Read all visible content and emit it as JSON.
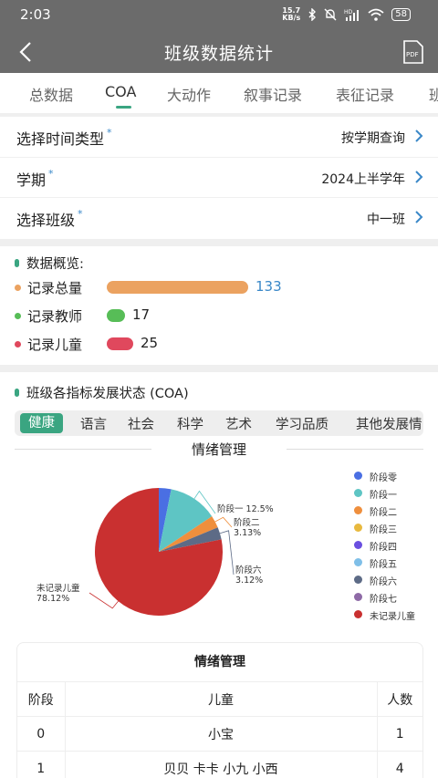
{
  "status_bar": {
    "time": "2:03",
    "net_speed_value": "15.7",
    "net_speed_unit": "KB/s",
    "battery": "58"
  },
  "header": {
    "title": "班级数据统计",
    "pdf_label": "PDF"
  },
  "tabs": [
    {
      "label": "总数据"
    },
    {
      "label": "COA"
    },
    {
      "label": "大动作"
    },
    {
      "label": "叙事记录"
    },
    {
      "label": "表征记录"
    },
    {
      "label": "班"
    }
  ],
  "filters": {
    "time_type": {
      "label": "选择时间类型",
      "required": "*",
      "value": "按学期查询"
    },
    "term": {
      "label": "学期",
      "required": "*",
      "value": "2024上半学年"
    },
    "class": {
      "label": "选择班级",
      "required": "*",
      "value": "中一班"
    }
  },
  "overview": {
    "title": "数据概览:",
    "rows": [
      {
        "label": "记录总量",
        "value": "133",
        "count": 133,
        "color": "#eba260",
        "value_color": "#3a88c8"
      },
      {
        "label": "记录教师",
        "value": "17",
        "count": 17,
        "color": "#57bd57",
        "value_color": "#222222"
      },
      {
        "label": "记录儿童",
        "value": "25",
        "count": 25,
        "color": "#e0485d",
        "value_color": "#222222"
      }
    ]
  },
  "coa": {
    "title": "班级各指标发展状态 (COA)",
    "subtabs": [
      "健康",
      "语言",
      "社会",
      "科学",
      "艺术",
      "学习品质",
      "其他发展情"
    ],
    "active_subtab": "健康",
    "accent": "#3aa581"
  },
  "chart_data": {
    "type": "pie",
    "title": "情绪管理",
    "legend_position": "right",
    "slices": [
      {
        "name": "阶段零",
        "value": 3.13,
        "color": "#4a6fe3",
        "label": ""
      },
      {
        "name": "阶段一",
        "value": 12.5,
        "color": "#5ec5c4",
        "label": "阶段一 12.5%"
      },
      {
        "name": "阶段二",
        "value": 3.13,
        "color": "#ef8f3d",
        "label": "阶段二\n3.13%"
      },
      {
        "name": "阶段三",
        "value": 0,
        "color": "#e8b93e",
        "label": ""
      },
      {
        "name": "阶段四",
        "value": 0,
        "color": "#6a4fe0",
        "label": ""
      },
      {
        "name": "阶段五",
        "value": 0,
        "color": "#7fbfe8",
        "label": ""
      },
      {
        "name": "阶段六",
        "value": 3.13,
        "color": "#5d6b86",
        "label": "阶段六\n3.12%"
      },
      {
        "name": "阶段七",
        "value": 0,
        "color": "#8e6aa6",
        "label": ""
      },
      {
        "name": "未记录儿童",
        "value": 78.12,
        "color": "#c93030",
        "label": "未记录儿童\n78.12%"
      }
    ]
  },
  "table": {
    "title": "情绪管理",
    "headers": [
      "阶段",
      "儿童",
      "人数"
    ],
    "rows": [
      [
        "0",
        "小宝",
        "1"
      ],
      [
        "1",
        "贝贝  卡卡  小九  小西",
        "4"
      ]
    ]
  }
}
